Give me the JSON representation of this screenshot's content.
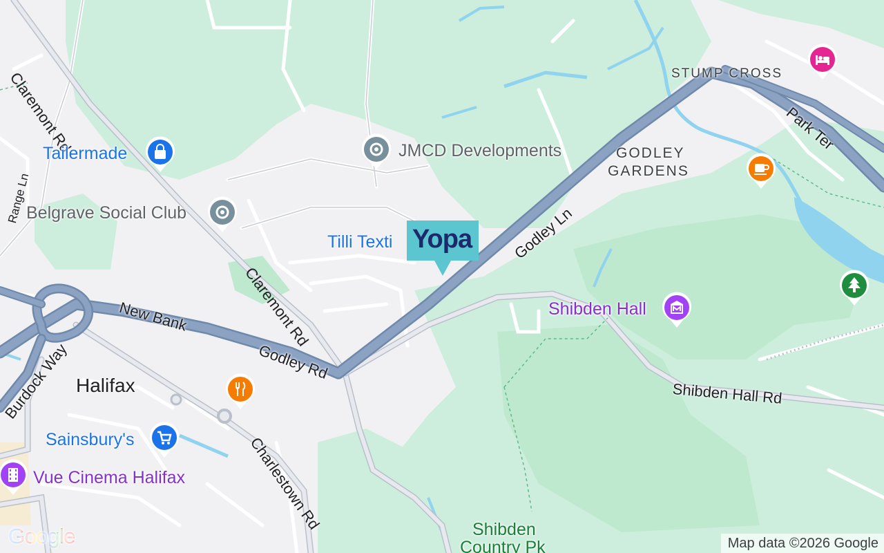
{
  "map": {
    "roads": {
      "claremont_rd_north": "Claremont Rd",
      "claremont_rd_south": "Claremont Rd",
      "range_ln": "Range Ln",
      "new_bank": "New Bank",
      "godley_rd": "Godley Rd",
      "godley_ln": "Godley Ln",
      "park_ter": "Park Ter",
      "burdock_way": "Burdock Way",
      "charlestown_rd": "Charlestown Rd",
      "shibden_hall_rd": "Shibden Hall Rd"
    },
    "areas": {
      "stump_cross": "STUMP CROSS",
      "godley_line1": "GODLEY",
      "godley_line2": "GARDENS",
      "halifax": "Halifax"
    },
    "pois": {
      "tailermade": {
        "label": "Tailermade",
        "icon": "shopping-bag-icon",
        "color": "#1a73e8"
      },
      "belgrave": {
        "label": "Belgrave Social Club",
        "icon": "generic-place-icon",
        "color": "#78909c"
      },
      "jmcd": {
        "label": "JMCD Developments",
        "icon": "generic-place-icon",
        "color": "#78909c"
      },
      "tilli": {
        "label": "Tilli Texti"
      },
      "shibden_hall": {
        "label": "Shibden Hall",
        "icon": "museum-icon",
        "color": "#a142f4"
      },
      "sainsburys": {
        "label": "Sainsbury's",
        "icon": "shopping-cart-icon",
        "color": "#1a73e8"
      },
      "vue": {
        "label": "Vue Cinema Halifax",
        "icon": "film-icon",
        "color": "#a142f4"
      },
      "shibden_park_line1": "Shibden",
      "shibden_park_line2": "Country Pk",
      "restaurant": {
        "icon": "fork-knife-icon",
        "color": "#f57c00"
      },
      "cafe": {
        "icon": "coffee-cup-icon",
        "color": "#f57c00"
      },
      "hotel": {
        "icon": "bed-icon",
        "color": "#e52592"
      },
      "park": {
        "icon": "tree-icon",
        "color": "#1e8e3e"
      }
    },
    "marker": {
      "label": "Yopa",
      "color": "#5bc6d0",
      "text_color": "#1b2a6b"
    },
    "google_logo": "Google",
    "attribution": "Map data ©2026 Google"
  }
}
